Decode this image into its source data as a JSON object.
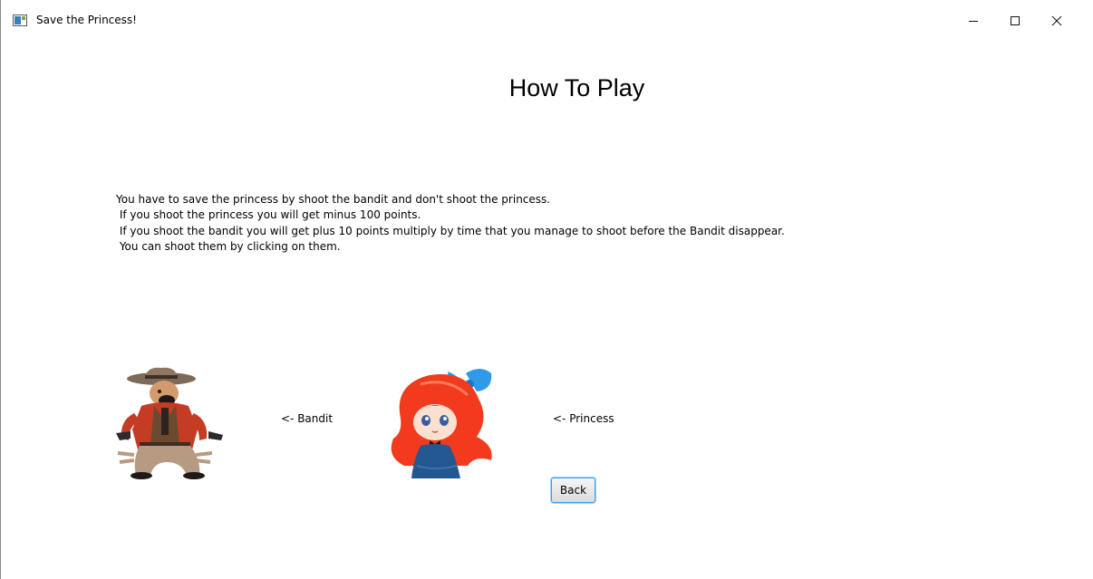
{
  "window": {
    "title": "Save the Princess!",
    "icon": "java-app-icon",
    "controls": [
      "minimize-icon",
      "maximize-icon",
      "close-icon"
    ]
  },
  "page": {
    "heading": "How To Play",
    "instructions": [
      "You have to save the princess by shoot the bandit and don't shoot the princess.",
      " If you shoot the princess you will get minus 100 points.",
      " If you shoot the bandit you will get plus 10 points multiply by time that you manage to shoot before the Bandit disappear.",
      " You can shoot them by clicking on them."
    ],
    "bandit_label": "<- Bandit",
    "princess_label": "<- Princess",
    "back_button": "Back"
  },
  "colors": {
    "button_focus": "#3c9ee6",
    "princess_hair": "#f23a1e",
    "princess_bow": "#2f9ae8",
    "princess_dress": "#23578f",
    "bandit_jacket": "#c43c24",
    "bandit_pants": "#b79a82",
    "bandit_hat": "#8e7760"
  }
}
